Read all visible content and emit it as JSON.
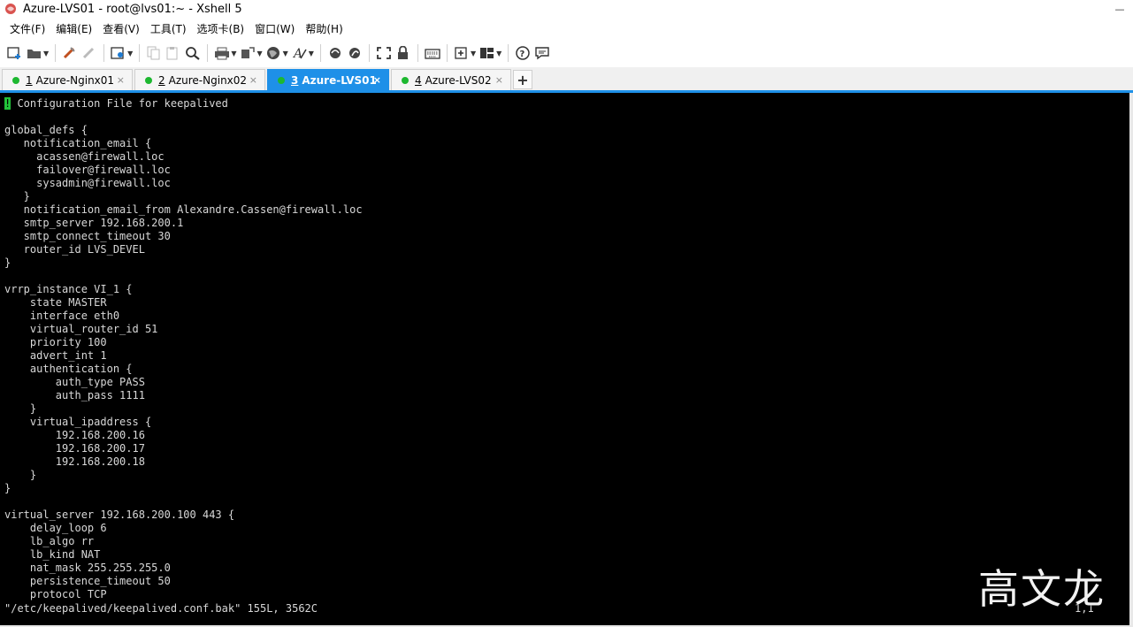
{
  "window": {
    "title": "Azure-LVS01 - root@lvs01:~ - Xshell 5",
    "control_glyph": "—"
  },
  "menu": {
    "items": [
      "文件(F)",
      "编辑(E)",
      "查看(V)",
      "工具(T)",
      "选项卡(B)",
      "窗口(W)",
      "帮助(H)"
    ]
  },
  "toolbar": {
    "icons": [
      "new-session-icon",
      "open-icon",
      "reconnect-icon",
      "disconnect-icon",
      "properties-icon",
      "copy-icon",
      "paste-icon",
      "find-icon",
      "print-icon",
      "transfer-icon",
      "globe-icon",
      "font-icon",
      "xftp-icon",
      "xftp-alt-icon",
      "fullscreen-icon",
      "lock-icon",
      "keyboard-icon",
      "new-tab-icon",
      "layout-icon",
      "help-icon",
      "chat-icon"
    ]
  },
  "tabs": [
    {
      "number": "1",
      "label": "Azure-Nginx01",
      "active": false
    },
    {
      "number": "2",
      "label": "Azure-Nginx02",
      "active": false
    },
    {
      "number": "3",
      "label": "Azure-LVS01",
      "active": true
    },
    {
      "number": "4",
      "label": "Azure-LVS02",
      "active": false
    }
  ],
  "tab_close_glyph": "×",
  "tab_add_label": "+",
  "terminal": {
    "first_line": " Configuration File for keepalived",
    "body": "\nglobal_defs {\n   notification_email {\n     acassen@firewall.loc\n     failover@firewall.loc\n     sysadmin@firewall.loc\n   }\n   notification_email_from Alexandre.Cassen@firewall.loc\n   smtp_server 192.168.200.1\n   smtp_connect_timeout 30\n   router_id LVS_DEVEL\n}\n\nvrrp_instance VI_1 {\n    state MASTER\n    interface eth0\n    virtual_router_id 51\n    priority 100\n    advert_int 1\n    authentication {\n        auth_type PASS\n        auth_pass 1111\n    }\n    virtual_ipaddress {\n        192.168.200.16\n        192.168.200.17\n        192.168.200.18\n    }\n}\n\nvirtual_server 192.168.200.100 443 {\n    delay_loop 6\n    lb_algo rr\n    lb_kind NAT\n    nat_mask 255.255.255.0\n    persistence_timeout 50\n    protocol TCP",
    "cursor_char": "!",
    "status": "\"/etc/keepalived/keepalived.conf.bak\" 155L, 3562C",
    "position": "1,1"
  },
  "watermark": "高文龙",
  "colors": {
    "tab_active": "#1e90e8",
    "status_dot": "#1db830",
    "terminal_bg": "#000000",
    "terminal_fg": "#d8d8d8",
    "cursor": "#22c33a"
  }
}
